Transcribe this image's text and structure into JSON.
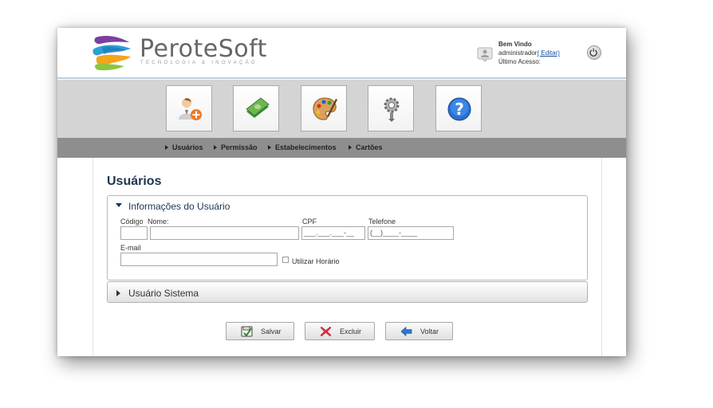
{
  "brand": {
    "name": "PeroteSoft",
    "tagline": "TECNOLOGIA & INOVAÇÃO"
  },
  "user_panel": {
    "welcome": "Bem Vindo",
    "username": "administrador",
    "edit_link": "( Editar)",
    "last_access": "Último Acesso:"
  },
  "toolbar": {
    "icons": [
      "add-user-icon",
      "money-icon",
      "palette-icon",
      "gear-icon",
      "help-icon"
    ]
  },
  "nav": {
    "items": [
      {
        "label": "Usuários"
      },
      {
        "label": "Permissão"
      },
      {
        "label": "Estabelecimentos"
      },
      {
        "label": "Cartões"
      }
    ]
  },
  "page": {
    "title": "Usuários"
  },
  "form": {
    "section_user_info": "Informações do Usuário",
    "codigo_label": "Código",
    "nome_label": "Nome:",
    "cpf_label": "CPF",
    "cpf_placeholder": "___.___.___-__",
    "telefone_label": "Telefone",
    "telefone_placeholder": "(__)____-____",
    "email_label": "E-mail",
    "horario_label": "Utilizar Horário",
    "section_system_user": "Usuário Sistema"
  },
  "actions": {
    "save": "Salvar",
    "delete": "Excluir",
    "back": "Voltar"
  },
  "colors": {
    "title": "#1b3553",
    "toolbar_bg": "#d4d4d4",
    "nav_bg": "#8e8e8e",
    "header_border": "#b9cfe0"
  }
}
